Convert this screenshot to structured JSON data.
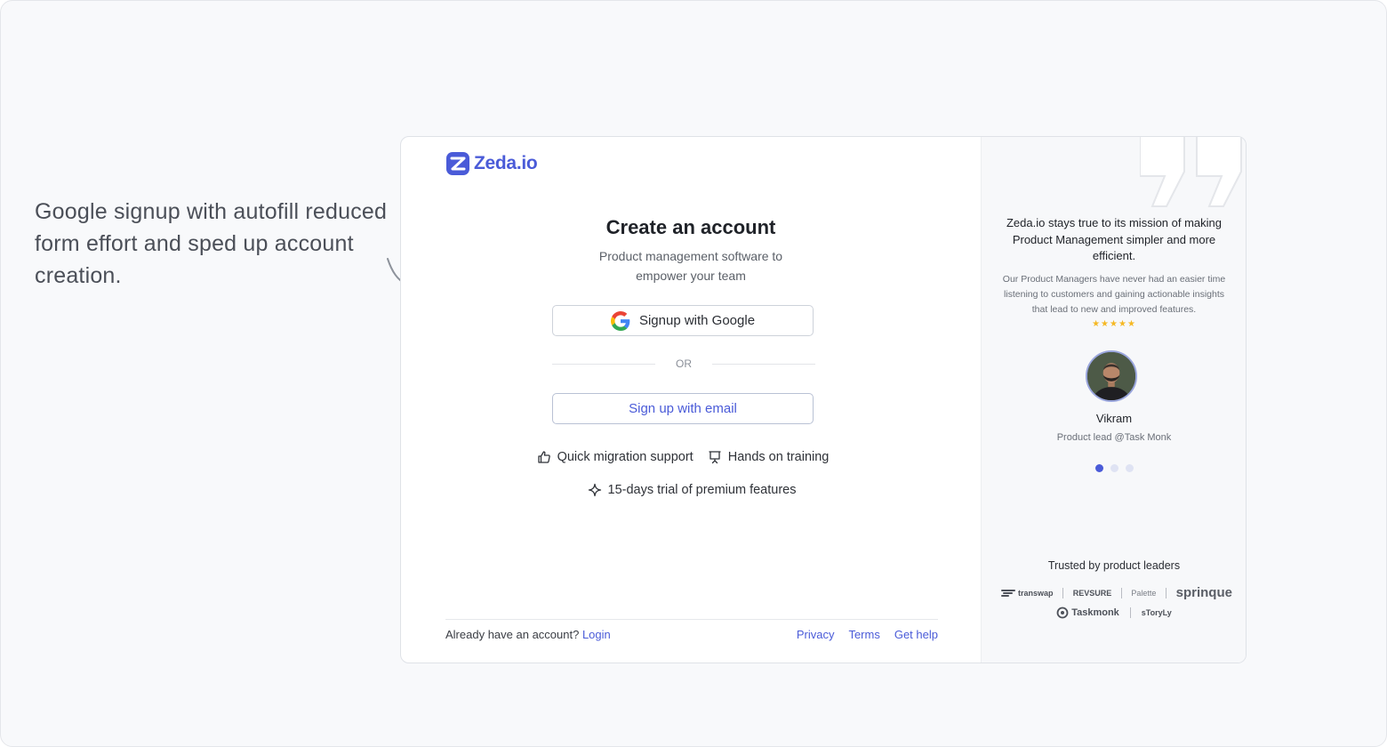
{
  "annotation": {
    "text": "Google signup with autofill reduced form effort and sped up account creation."
  },
  "brand": {
    "name": "Zeda.io",
    "color": "#4a5bd8"
  },
  "signup": {
    "title": "Create an account",
    "subtitle": "Product management software to empower your team",
    "google_button": "Signup with Google",
    "or_label": "OR",
    "email_button": "Sign up with email"
  },
  "features": [
    {
      "label": "Quick migration support",
      "icon": "thumbs-up-icon"
    },
    {
      "label": "Hands on training",
      "icon": "presentation-icon"
    },
    {
      "label": "15-days trial of premium features",
      "icon": "sparkle-icon"
    }
  ],
  "footer": {
    "prompt": "Already have an account?",
    "login": "Login",
    "links": [
      "Privacy",
      "Terms",
      "Get help"
    ]
  },
  "testimonial": {
    "headline": "Zeda.io stays true to its mission of making Product Management simpler and more efficient.",
    "body": "Our Product Managers have never had an easier time listening to customers and gaining actionable insights that lead to new and improved features.",
    "stars": "★★★★★",
    "rating": 5,
    "name": "Vikram",
    "role": "Product lead @Task Monk",
    "active_slide": 1,
    "slide_count": 3
  },
  "trusted": {
    "title": "Trusted by product leaders",
    "logos": [
      "transwap",
      "REVSURE",
      "Palette",
      "sprinque",
      "Taskmonk",
      "sToryLy"
    ]
  }
}
